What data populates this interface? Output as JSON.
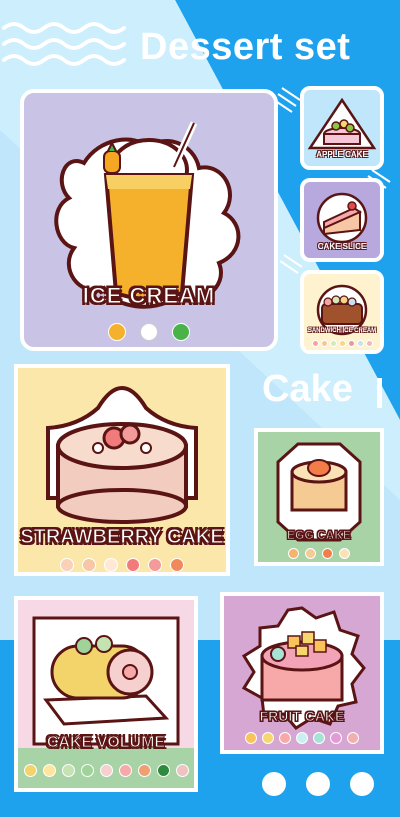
{
  "header": {
    "title": "Dessert set"
  },
  "section": {
    "title": "Cake"
  },
  "colors": {
    "background": "#1ea2ee",
    "outline": "#5a1414",
    "light_band": "#bfe6fb"
  },
  "products": [
    {
      "name": "ICE CREAM",
      "bg": "#c9c4e6",
      "swatches": [
        "#f5b12c",
        "#ffffff",
        "#49b248"
      ]
    },
    {
      "name": "APPLE CAKE",
      "bg": "#bfe6fb",
      "swatches": []
    },
    {
      "name": "CAKE SLICE",
      "bg": "#b7a8de",
      "swatches": []
    },
    {
      "name": "SANDWICH ICE CREAM",
      "bg": "#fff2cf",
      "swatches": [
        "#f5a2a2",
        "#f2c6a1",
        "#d6e8b4",
        "#f7d58a",
        "#e79a9a",
        "#c9e0f0",
        "#f0b8b8"
      ]
    },
    {
      "name": "STRAWBERRY CAKE",
      "bg": "#fbe7a9",
      "swatches": [
        "#f9d0b8",
        "#f6c6a5",
        "#ffe9d6",
        "#f17a7a",
        "#f39a9a",
        "#f08a5a"
      ]
    },
    {
      "name": "EGG CAKE",
      "bg": "#a7d3a6",
      "swatches": [
        "#f5b36b",
        "#f6ca93",
        "#f27d48",
        "#fbe1b6"
      ]
    },
    {
      "name": "CAKE VOLUME",
      "bg": "#f6d9e5",
      "swatches": [
        "#f3d46a",
        "#ffe69c",
        "#c4e3b0",
        "#9fd39a",
        "#f6cfcf",
        "#f7a9a9",
        "#f0a06e",
        "#2e8a3f",
        "#f1c2c2"
      ]
    },
    {
      "name": "FRUIT CAKE",
      "bg": "#d7a7d4",
      "swatches": [
        "#f9c25a",
        "#f5d76e",
        "#f7a8a8",
        "#c9f0f0",
        "#a6e3d6",
        "#e39ad6",
        "#f0b0b0"
      ]
    }
  ],
  "pager": {
    "count": 3
  }
}
